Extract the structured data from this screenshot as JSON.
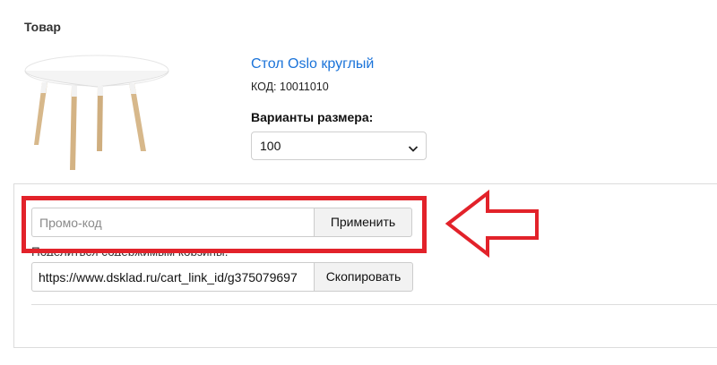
{
  "section": {
    "title": "Товар"
  },
  "product": {
    "name": "Стол Oslo круглый",
    "code": "КОД: 10011010",
    "variants_label": "Варианты размера:",
    "selected_size": "100"
  },
  "cart": {
    "promo_placeholder": "Промо-код",
    "apply_label": "Применить",
    "share_label": "Поделиться содержимым корзины:",
    "share_link": "https://www.dsklad.ru/cart_link_id/g375079697",
    "copy_label": "Скопировать"
  },
  "colors": {
    "link": "#1a73d9",
    "annotation": "#e2222a"
  },
  "icons": {
    "product_image": "round-table-image",
    "select_arrow": "chevron-down-icon",
    "annotation_arrow": "left-arrow-icon"
  }
}
